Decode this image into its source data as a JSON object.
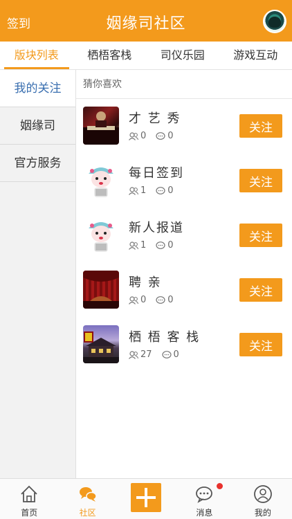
{
  "header": {
    "sign_in": "签到",
    "title": "姻缘司社区",
    "avatar_icon": "user-avatar"
  },
  "tabs": [
    {
      "label": "版块列表",
      "active": true
    },
    {
      "label": "栖梧客栈",
      "active": false
    },
    {
      "label": "司仪乐园",
      "active": false
    },
    {
      "label": "游戏互动",
      "active": false
    }
  ],
  "sidebar": {
    "items": [
      {
        "label": "我的关注",
        "active": true
      },
      {
        "label": "姻缘司",
        "active": false
      },
      {
        "label": "官方服务",
        "active": false
      }
    ]
  },
  "content": {
    "section_label": "猜你喜欢",
    "follow_label": "关注",
    "forums": [
      {
        "name": "才 艺 秀",
        "members": "0",
        "posts": "0",
        "thumb": "piano-performance-image"
      },
      {
        "name": "每日签到",
        "members": "1",
        "posts": "0",
        "thumb": "opera-mascot-image"
      },
      {
        "name": "新人报道",
        "members": "1",
        "posts": "0",
        "thumb": "opera-mascot-image"
      },
      {
        "name": "聘   亲",
        "members": "0",
        "posts": "0",
        "thumb": "red-curtain-image"
      },
      {
        "name": "栖 梧 客 栈",
        "members": "27",
        "posts": "0",
        "thumb": "inn-building-image"
      }
    ]
  },
  "bottom_nav": [
    {
      "label": "首页",
      "icon": "home-icon",
      "active": false
    },
    {
      "label": "社区",
      "icon": "chat-bubbles-icon",
      "active": true
    },
    {
      "label": "",
      "icon": "plus-icon",
      "active": false
    },
    {
      "label": "消息",
      "icon": "message-icon",
      "active": false,
      "badge": true
    },
    {
      "label": "我的",
      "icon": "profile-icon",
      "active": false
    }
  ],
  "colors": {
    "accent": "#f39a1c",
    "sidebar_active_text": "#3a6fb0",
    "badge": "#e8312d"
  }
}
